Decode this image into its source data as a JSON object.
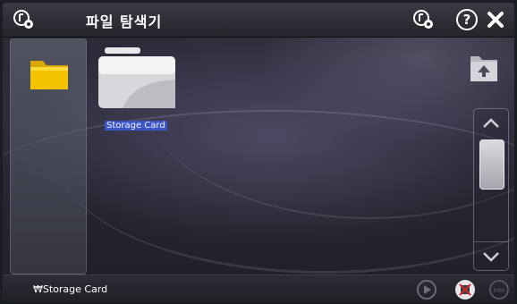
{
  "window": {
    "title": "파일 탐색기"
  },
  "toolbar": {
    "app_icon": "gear-settings-icon",
    "settings_icon": "gear-settings-icon",
    "help_icon": "question-circle-icon",
    "close_icon": "close-x-icon"
  },
  "sidebar": {
    "folder_icon": "folder-icon"
  },
  "files": [
    {
      "name": "Storage Card",
      "icon": "storage-card-folder-icon",
      "selected": true
    }
  ],
  "navigation": {
    "up_icon": "folder-up-icon"
  },
  "scrollbar": {
    "up_icon": "chevron-up-icon",
    "down_icon": "chevron-down-icon"
  },
  "status": {
    "path": "₩Storage Card",
    "play_icon": "play-icon",
    "stop_icon": "stop-icon",
    "info_label": "info"
  },
  "colors": {
    "selection": "#3a55c8",
    "folder": "#f5c400"
  }
}
